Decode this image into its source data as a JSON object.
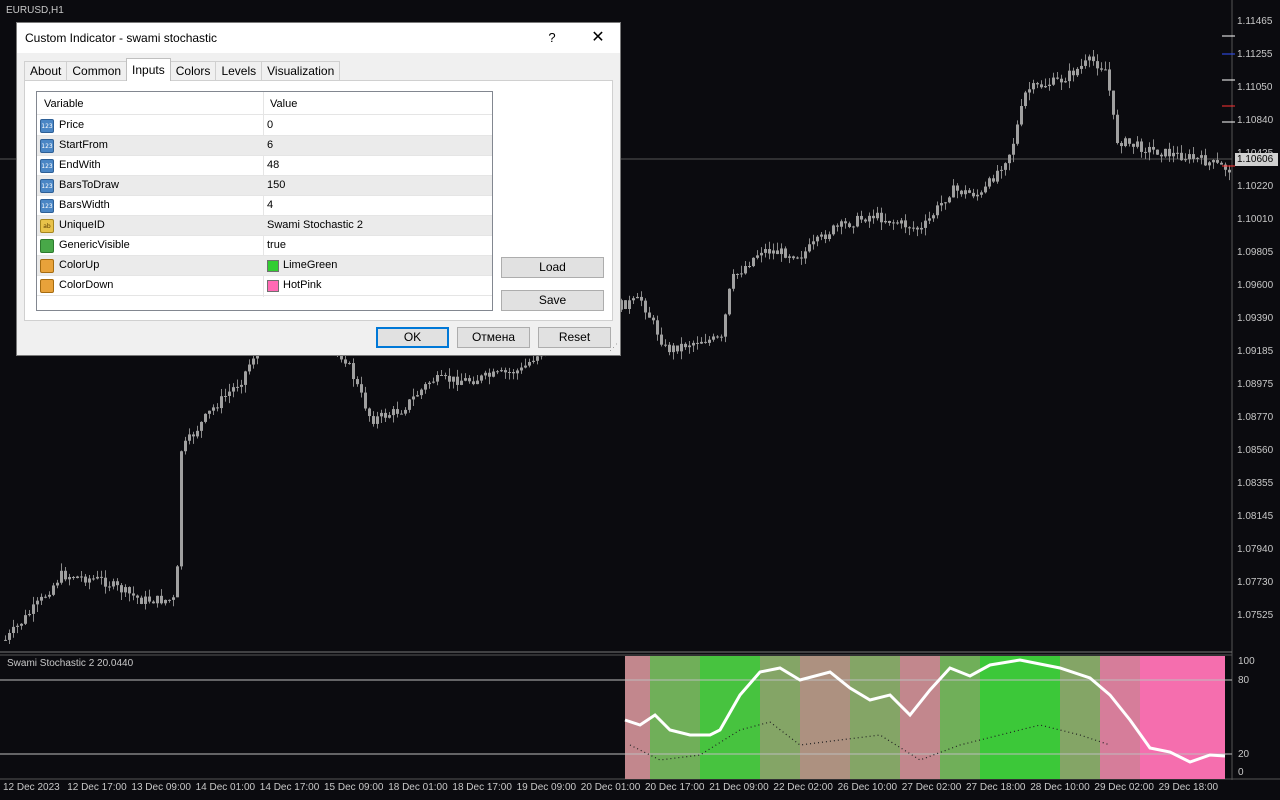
{
  "chart": {
    "title": "EURUSD,H1",
    "current_price": "1.10606",
    "price_labels": [
      "1.11465",
      "1.11255",
      "1.11050",
      "1.10840",
      "1.10425",
      "1.10220",
      "1.10010",
      "1.09805",
      "1.09600",
      "1.09390",
      "1.09185",
      "1.08975",
      "1.08770",
      "1.08560",
      "1.08355",
      "1.08145",
      "1.07940",
      "1.07730",
      "1.07525"
    ],
    "date_labels": [
      "12 Dec 2023",
      "12 Dec 17:00",
      "13 Dec 09:00",
      "14 Dec 01:00",
      "14 Dec 17:00",
      "15 Dec 09:00",
      "18 Dec 01:00",
      "18 Dec 17:00",
      "19 Dec 09:00",
      "20 Dec 01:00",
      "20 Dec 17:00",
      "21 Dec 09:00",
      "22 Dec 02:00",
      "26 Dec 10:00",
      "27 Dec 02:00",
      "27 Dec 18:00",
      "28 Dec 10:00",
      "29 Dec 02:00",
      "29 Dec 18:00"
    ],
    "colors": {
      "background": "#0b0b0f",
      "candles": "#9a9a9a",
      "grid": "#3a3a3a"
    }
  },
  "oscillator": {
    "title": "Swami Stochastic 2 20.0440",
    "levels": [
      "100",
      "80",
      "20",
      "0"
    ],
    "color_up": "#32CD32",
    "color_down": "#FF69B4"
  },
  "dialog": {
    "title": "Custom Indicator - swami stochastic",
    "help_label": "?",
    "close_label": "✕",
    "tabs": [
      "About",
      "Common",
      "Inputs",
      "Colors",
      "Levels",
      "Visualization"
    ],
    "active_tab": "Inputs",
    "columns": {
      "variable": "Variable",
      "value": "Value"
    },
    "rows": [
      {
        "name": "Price",
        "value": "0",
        "icon": "int-icon",
        "icon_text": "123"
      },
      {
        "name": "StartFrom",
        "value": "6",
        "icon": "int-icon",
        "icon_text": "123"
      },
      {
        "name": "EndWith",
        "value": "48",
        "icon": "int-icon",
        "icon_text": "123"
      },
      {
        "name": "BarsToDraw",
        "value": "150",
        "icon": "int-icon",
        "icon_text": "123"
      },
      {
        "name": "BarsWidth",
        "value": "4",
        "icon": "int-icon",
        "icon_text": "123"
      },
      {
        "name": "UniqueID",
        "value": "Swami Stochastic 2",
        "icon": "string-icon",
        "icon_text": "ab"
      },
      {
        "name": "GenericVisible",
        "value": "true",
        "icon": "bool-icon",
        "icon_text": ""
      },
      {
        "name": "ColorUp",
        "value": "LimeGreen",
        "icon": "color-icon",
        "icon_text": "",
        "swatch": "#32CD32"
      },
      {
        "name": "ColorDown",
        "value": "HotPink",
        "icon": "color-icon",
        "icon_text": "",
        "swatch": "#FF69B4"
      }
    ],
    "buttons": {
      "load": "Load",
      "save": "Save",
      "ok": "OK",
      "cancel": "Отмена",
      "reset": "Reset"
    }
  }
}
